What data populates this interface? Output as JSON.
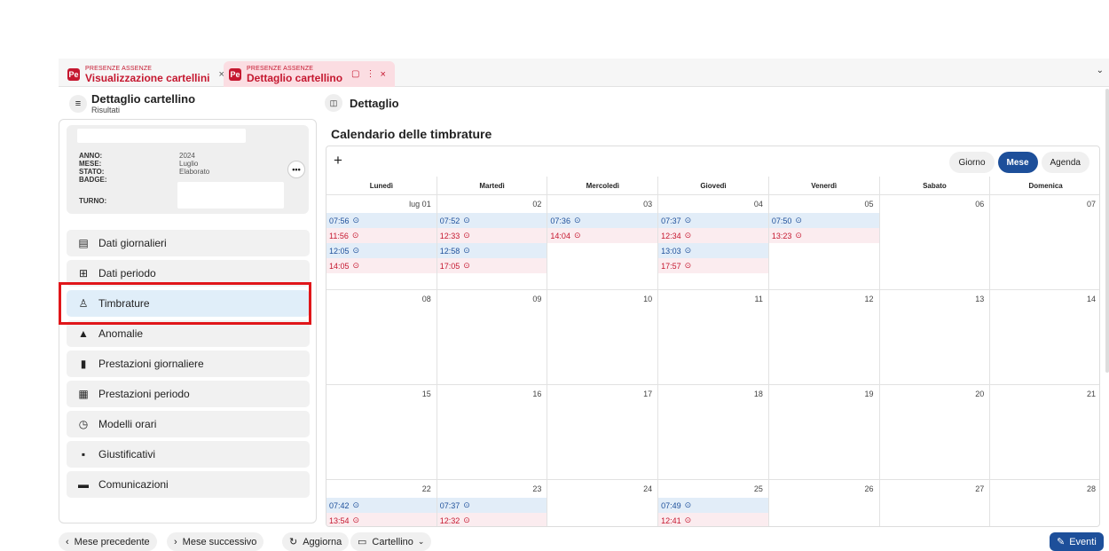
{
  "tabs": [
    {
      "subtitle": "PRESENZE ASSENZE",
      "title": "Visualizzazione cartellini",
      "close": "×"
    },
    {
      "subtitle": "PRESENZE ASSENZE",
      "title": "Dettaglio cartellino",
      "close": "×"
    }
  ],
  "left_header": {
    "title": "Dettaglio cartellino",
    "subtitle": "Risultati"
  },
  "right_header": {
    "title": "Dettaglio"
  },
  "info": {
    "anno_label": "ANNO:",
    "anno": "2024",
    "mese_label": "MESE:",
    "mese": "Luglio",
    "stato_label": "STATO:",
    "stato": "Elaborato",
    "badge_label": "BADGE:",
    "turno_label": "TURNO:"
  },
  "menu": [
    {
      "label": "Dati giornalieri",
      "icon": "calendar-day-icon"
    },
    {
      "label": "Dati periodo",
      "icon": "grid-icon"
    },
    {
      "label": "Timbrature",
      "icon": "user-badge-icon"
    },
    {
      "label": "Anomalie",
      "icon": "warning-icon"
    },
    {
      "label": "Prestazioni giornaliere",
      "icon": "document-icon"
    },
    {
      "label": "Prestazioni periodo",
      "icon": "calendar-list-icon"
    },
    {
      "label": "Modelli orari",
      "icon": "calendar-clock-icon"
    },
    {
      "label": "Giustificativi",
      "icon": "document-plus-icon"
    },
    {
      "label": "Comunicazioni",
      "icon": "message-icon"
    }
  ],
  "calendar": {
    "title": "Calendario delle timbrature",
    "views": [
      "Giorno",
      "Mese",
      "Agenda"
    ],
    "selected_view": "Mese",
    "weekdays": [
      "Lunedì",
      "Martedì",
      "Mercoledì",
      "Giovedì",
      "Venerdì",
      "Sabato",
      "Domenica"
    ],
    "weeks": [
      [
        {
          "day": "lug 01",
          "entries": [
            {
              "time": "07:56",
              "type": "in"
            },
            {
              "time": "11:56",
              "type": "out"
            },
            {
              "time": "12:05",
              "type": "in"
            },
            {
              "time": "14:05",
              "type": "out"
            }
          ]
        },
        {
          "day": "02",
          "entries": [
            {
              "time": "07:52",
              "type": "in"
            },
            {
              "time": "12:33",
              "type": "out"
            },
            {
              "time": "12:58",
              "type": "in"
            },
            {
              "time": "17:05",
              "type": "out"
            }
          ]
        },
        {
          "day": "03",
          "entries": [
            {
              "time": "07:36",
              "type": "in"
            },
            {
              "time": "14:04",
              "type": "out"
            }
          ]
        },
        {
          "day": "04",
          "entries": [
            {
              "time": "07:37",
              "type": "in"
            },
            {
              "time": "12:34",
              "type": "out"
            },
            {
              "time": "13:03",
              "type": "in"
            },
            {
              "time": "17:57",
              "type": "out"
            }
          ]
        },
        {
          "day": "05",
          "entries": [
            {
              "time": "07:50",
              "type": "in"
            },
            {
              "time": "13:23",
              "type": "out"
            }
          ]
        },
        {
          "day": "06",
          "entries": []
        },
        {
          "day": "07",
          "entries": []
        }
      ],
      [
        {
          "day": "08",
          "entries": []
        },
        {
          "day": "09",
          "entries": []
        },
        {
          "day": "10",
          "entries": []
        },
        {
          "day": "11",
          "entries": []
        },
        {
          "day": "12",
          "entries": []
        },
        {
          "day": "13",
          "entries": []
        },
        {
          "day": "14",
          "entries": []
        }
      ],
      [
        {
          "day": "15",
          "entries": []
        },
        {
          "day": "16",
          "entries": []
        },
        {
          "day": "17",
          "entries": []
        },
        {
          "day": "18",
          "entries": []
        },
        {
          "day": "19",
          "entries": []
        },
        {
          "day": "20",
          "entries": []
        },
        {
          "day": "21",
          "entries": []
        }
      ],
      [
        {
          "day": "22",
          "entries": [
            {
              "time": "07:42",
              "type": "in"
            },
            {
              "time": "13:54",
              "type": "out"
            }
          ]
        },
        {
          "day": "23",
          "entries": [
            {
              "time": "07:37",
              "type": "in"
            },
            {
              "time": "12:32",
              "type": "out"
            }
          ]
        },
        {
          "day": "24",
          "entries": []
        },
        {
          "day": "25",
          "entries": [
            {
              "time": "07:49",
              "type": "in"
            },
            {
              "time": "12:41",
              "type": "out"
            }
          ]
        },
        {
          "day": "26",
          "entries": []
        },
        {
          "day": "27",
          "entries": []
        },
        {
          "day": "28",
          "entries": []
        }
      ]
    ]
  },
  "footer": {
    "prev": "Mese precedente",
    "next": "Mese successivo",
    "refresh": "Aggiorna",
    "card": "Cartellino",
    "events": "Eventi"
  },
  "colors": {
    "brand": "#c5172f",
    "accent": "#1d4f9a",
    "highlight": "#e0161a"
  }
}
